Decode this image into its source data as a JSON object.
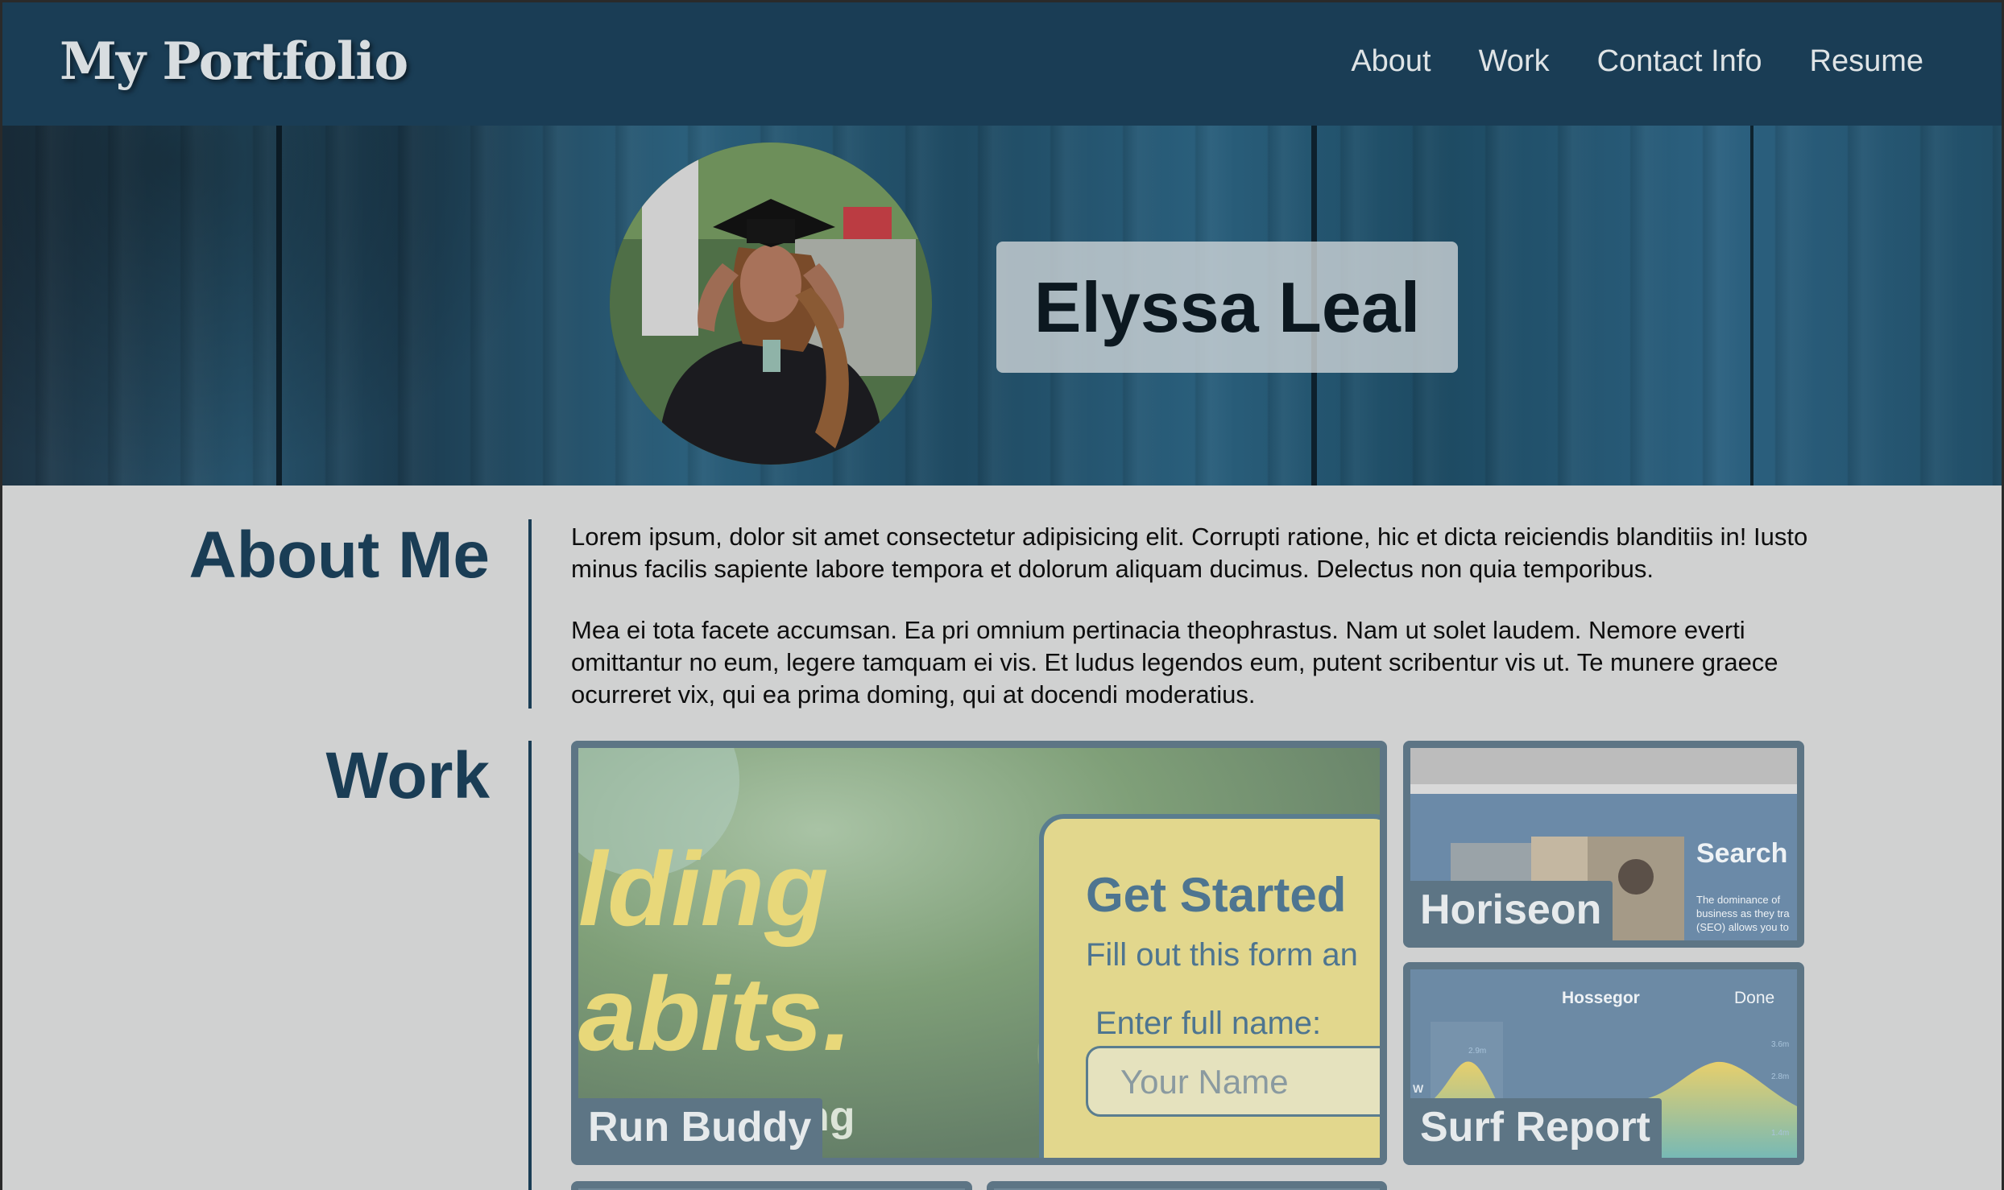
{
  "header": {
    "brand": "My Portfolio",
    "nav": [
      "About",
      "Work",
      "Contact Info",
      "Resume"
    ]
  },
  "hero": {
    "name": "Elyssa Leal"
  },
  "about": {
    "title": "About Me",
    "paragraphs": [
      "Lorem ipsum, dolor sit amet consectetur adipisicing elit. Corrupti ratione, hic et dicta reiciendis blanditiis in! Iusto minus facilis sapiente labore tempora et dolorum aliquam ducimus. Delectus non quia temporibus.",
      "Mea ei tota facete accumsan. Ea pri omnium pertinacia theophrastus. Nam ut solet laudem. Nemore everti omittantur no eum, legere tamquam ei vis. Et ludus legendos eum, putent scribentur vis ut. Te munere graece ocurreret vix, qui ea prima doming, qui at docendi moderatius."
    ]
  },
  "work": {
    "title": "Work",
    "projects": [
      {
        "label": "Run Buddy",
        "screenshot_text": [
          "lding",
          "abits.",
          "ng",
          "Get Started",
          "Fill out this form an",
          "Enter full name:",
          "Your Name"
        ]
      },
      {
        "label": "Horiseon",
        "screenshot_text": [
          "Search",
          "The dominance of",
          "business as they tra",
          "(SEO) allows you to"
        ]
      },
      {
        "label": "Surf Report",
        "screenshot_text": [
          "Hossegor",
          "Done",
          "2.9m",
          "W",
          "3.6m",
          "2.8m",
          "1.4m"
        ]
      }
    ]
  }
}
